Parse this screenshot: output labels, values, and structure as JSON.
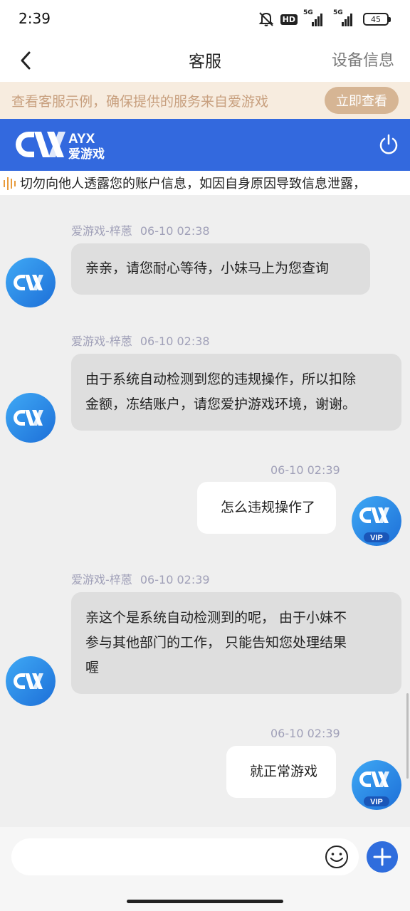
{
  "status_bar": {
    "time": "2:39",
    "hd_badge": "HD",
    "network1": "5G",
    "network2": "5G",
    "battery": "45"
  },
  "nav": {
    "title": "客服",
    "right_label": "设备信息"
  },
  "notice": {
    "text": "查看客服示例，确保提供的服务来自爱游戏",
    "button": "立即查看"
  },
  "brand": {
    "latin": "AYX",
    "chinese": "爱游戏",
    "color": "#3369de"
  },
  "marquee": {
    "text": "切勿向他人透露您的账户信息，如因自身原因导致信息泄露，"
  },
  "messages": [
    {
      "sender": "agent",
      "name": "爱游戏-梓蒽",
      "time": "06-10 02:38",
      "lines": [
        "亲亲，请您耐心等待，小妹马上为您查询"
      ]
    },
    {
      "sender": "agent",
      "name": "爱游戏-梓蒽",
      "time": "06-10 02:38",
      "lines": [
        "由于系统自动检测到您的违规操作，所以扣除",
        "金额，冻结账户，请您爱护游戏环境，谢谢。"
      ]
    },
    {
      "sender": "user",
      "time": "06-10 02:39",
      "lines": [
        "怎么违规操作了"
      ],
      "badge": "VIP"
    },
    {
      "sender": "agent",
      "name": "爱游戏-梓蒽",
      "time": "06-10 02:39",
      "lines": [
        "亲这个是系统自动检测到的呢， 由于小妹不",
        "参与其他部门的工作， 只能告知您处理结果",
        "喔"
      ]
    },
    {
      "sender": "user",
      "time": "06-10 02:39",
      "lines": [
        "就正常游戏"
      ],
      "badge": "VIP"
    }
  ],
  "input": {
    "placeholder": ""
  },
  "icons": {
    "back": "chevron-left-icon",
    "power": "power-icon",
    "marquee": "sound-wave-icon",
    "emoji": "smiley-icon",
    "plus": "plus-icon"
  }
}
